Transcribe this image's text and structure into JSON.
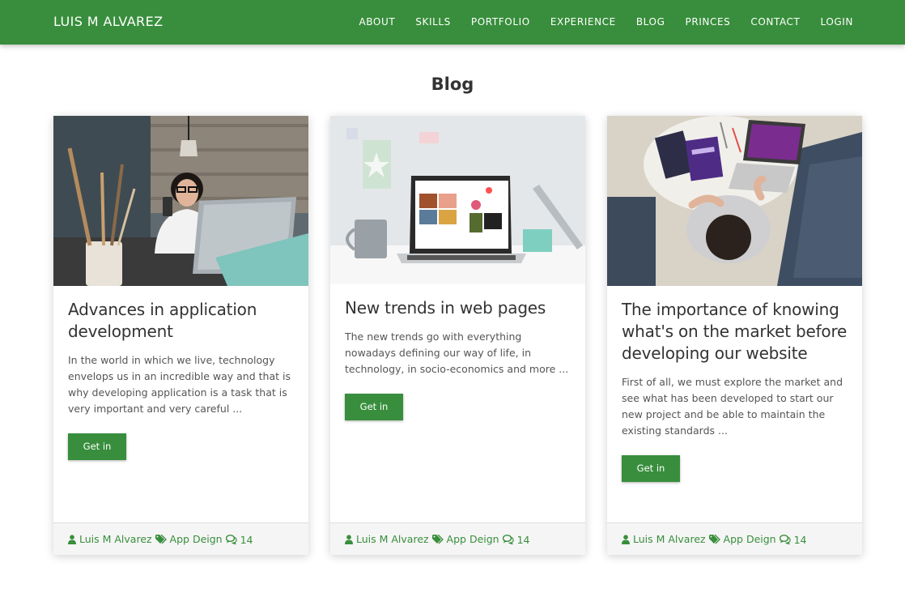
{
  "navbar": {
    "brand": "LUIS M ALVAREZ",
    "links": [
      "ABOUT",
      "SKILLS",
      "PORTFOLIO",
      "EXPERIENCE",
      "BLOG",
      "PRINCES",
      "CONTACT",
      "LOGIN"
    ]
  },
  "blog": {
    "title": "Blog",
    "cards": [
      {
        "image": "woman-with-phone-and-laptop-photo",
        "title": "Advances in application development",
        "text": "In the world in which we live, technology envelops us in an incredible way and that is why developing application is a task that is very important and very careful ...",
        "button": "Get in",
        "author": "Luis M Alvarez",
        "category": "App Deign",
        "comments": "14"
      },
      {
        "image": "laptop-on-desk-photo",
        "title": "New trends in web pages",
        "text": "The new trends go with everything nowadays defining our way of life, in technology, in socio-economics and more ...",
        "button": "Get in",
        "author": "Luis M Alvarez",
        "category": "App Deign",
        "comments": "14"
      },
      {
        "image": "overhead-person-with-laptop-photo",
        "title": "The importance of knowing what's on the market before developing our website",
        "text": "First of all, we must explore the market and see what has been developed to start our new project and be able to maintain the existing standards ...",
        "button": "Get in",
        "author": "Luis M Alvarez",
        "category": "App Deign",
        "comments": "14"
      }
    ]
  },
  "colors": {
    "primary": "#388e3c",
    "footer_bg": "#f5f5f5"
  },
  "icons": {
    "author": "user-icon",
    "category": "tags-icon",
    "comments": "comments-icon"
  }
}
